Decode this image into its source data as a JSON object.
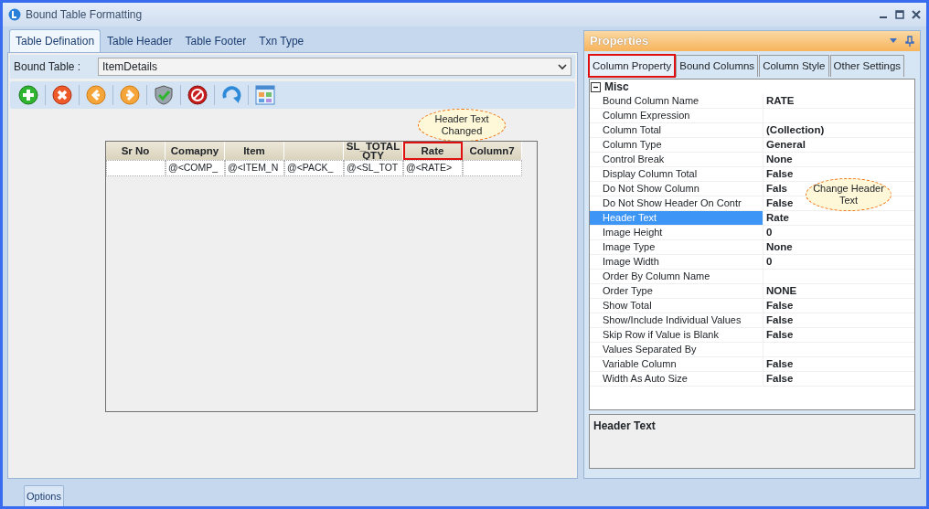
{
  "window": {
    "title": "Bound Table Formatting"
  },
  "left_tabs": [
    {
      "label": "Table Defination",
      "selected": true
    },
    {
      "label": "Table Header",
      "selected": false
    },
    {
      "label": "Table Footer",
      "selected": false
    },
    {
      "label": "Txn Type",
      "selected": false
    }
  ],
  "bound_table": {
    "label": "Bound Table :",
    "value": "ItemDetails"
  },
  "toolbar": [
    {
      "kind": "add"
    },
    {
      "kind": "delete"
    },
    {
      "kind": "back"
    },
    {
      "kind": "forward"
    },
    {
      "kind": "shield"
    },
    {
      "kind": "stop"
    },
    {
      "kind": "refresh"
    },
    {
      "kind": "grid"
    }
  ],
  "table": {
    "callout": "Header Text Changed",
    "columns": [
      {
        "label": "Sr No",
        "highlighted": false
      },
      {
        "label": "Comapny",
        "highlighted": false
      },
      {
        "label": "Item",
        "highlighted": false
      },
      {
        "highlighted": false
      },
      {
        "label": "SL_TOTAL QTY",
        "highlighted": false
      },
      {
        "label": "Rate",
        "highlighted": true
      },
      {
        "label": "Column7",
        "highlighted": false
      }
    ],
    "rows": [
      [
        "",
        "@<COMP_",
        "@<ITEM_N",
        "@<PACK_",
        "@<SL_TOT",
        "@<RATE>",
        ""
      ]
    ]
  },
  "properties": {
    "title": "Properties",
    "tabs": [
      {
        "label": "Column Property",
        "selected": true,
        "highlighted": true
      },
      {
        "label": "Bound Columns",
        "selected": false,
        "highlighted": false
      },
      {
        "label": "Column Style",
        "selected": false,
        "highlighted": false
      },
      {
        "label": "Other Settings",
        "selected": false,
        "highlighted": false
      }
    ],
    "category": {
      "label": "Misc",
      "expanded": true
    },
    "callout": "Change Header Text",
    "rows": [
      {
        "name": "Bound Column Name",
        "value": "RATE",
        "selected": false
      },
      {
        "name": "Column Expression",
        "value": "",
        "selected": false
      },
      {
        "name": "Column Total",
        "value": "(Collection)",
        "selected": false
      },
      {
        "name": "Column Type",
        "value": "General",
        "selected": false
      },
      {
        "name": "Control Break",
        "value": "None",
        "selected": false
      },
      {
        "name": "Display Column Total",
        "value": "False",
        "selected": false
      },
      {
        "name": "Do Not Show Column",
        "value": "Fals",
        "selected": false
      },
      {
        "name": "Do Not Show Header On Contr",
        "value": "False",
        "selected": false
      },
      {
        "name": "Header Text",
        "value": "Rate",
        "selected": true
      },
      {
        "name": "Image Height",
        "value": "0",
        "selected": false
      },
      {
        "name": "Image Type",
        "value": "None",
        "selected": false
      },
      {
        "name": "Image Width",
        "value": "0",
        "selected": false
      },
      {
        "name": "Order By Column Name",
        "value": "",
        "selected": false
      },
      {
        "name": "Order Type",
        "value": "NONE",
        "selected": false
      },
      {
        "name": "Show Total",
        "value": "False",
        "selected": false
      },
      {
        "name": "Show/Include Individual Values",
        "value": "False",
        "selected": false
      },
      {
        "name": "Skip Row if Value is Blank",
        "value": "False",
        "selected": false
      },
      {
        "name": "Values Separated By",
        "value": "",
        "selected": false
      },
      {
        "name": "Variable Column",
        "value": "False",
        "selected": false
      },
      {
        "name": "Width As Auto Size",
        "value": "False",
        "selected": false
      }
    ],
    "description": "Header Text"
  },
  "options_button": "Options"
}
